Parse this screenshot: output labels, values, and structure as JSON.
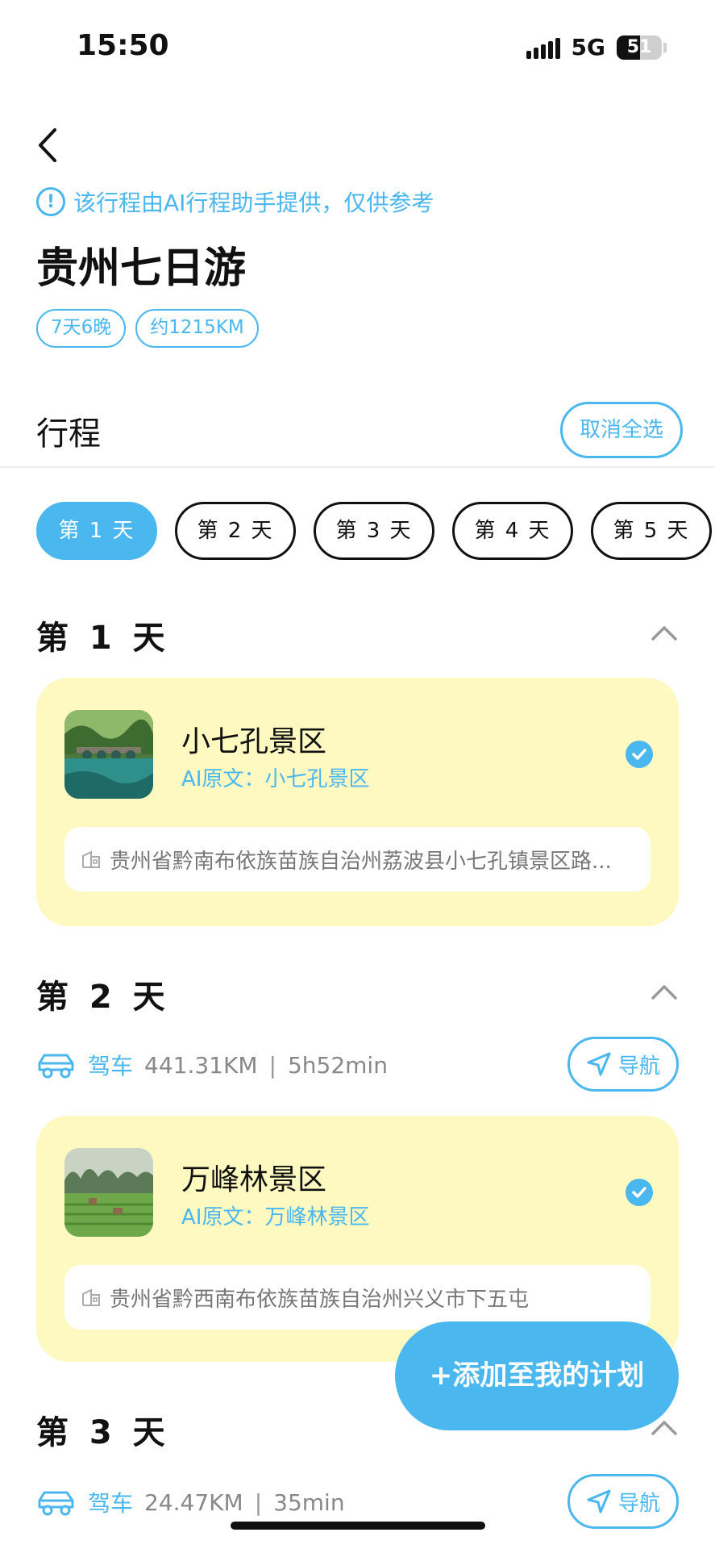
{
  "status_bar": {
    "time": "15:50",
    "network": "5G",
    "battery": "51",
    "battery_level": 0.51
  },
  "header": {
    "notice": "该行程由AI行程助手提供，仅供参考",
    "title": "贵州七日游",
    "tags": [
      "7天6晚",
      "约1215KM"
    ]
  },
  "section": {
    "title": "行程",
    "cancel_label": "取消全选"
  },
  "day_tabs": [
    "第 1 天",
    "第 2 天",
    "第 3 天",
    "第 4 天",
    "第 5 天"
  ],
  "active_tab": 0,
  "days": [
    {
      "heading": "第 1 天",
      "spot": {
        "name": "小七孔景区",
        "origin": "AI原文：小七孔景区",
        "address": "贵州省黔南布依族苗族自治州荔波县小七孔镇景区路...",
        "checked": true
      }
    },
    {
      "heading": "第 2 天",
      "drive": {
        "label": "驾车",
        "distance": "441.31KM",
        "separator": "|",
        "duration": "5h52min",
        "nav_label": "导航"
      },
      "spot": {
        "name": "万峰林景区",
        "origin": "AI原文：万峰林景区",
        "address": "贵州省黔西南布依族苗族自治州兴义市下五屯",
        "checked": true
      }
    },
    {
      "heading": "第 3 天",
      "drive": {
        "label": "驾车",
        "distance": "24.47KM",
        "separator": "|",
        "duration": "35min",
        "nav_label": "导航"
      }
    }
  ],
  "add_plan_label": "+添加至我的计划",
  "colors": {
    "accent": "#4bb7ef",
    "card_bg": "#fdf9c0",
    "text": "#111111"
  }
}
